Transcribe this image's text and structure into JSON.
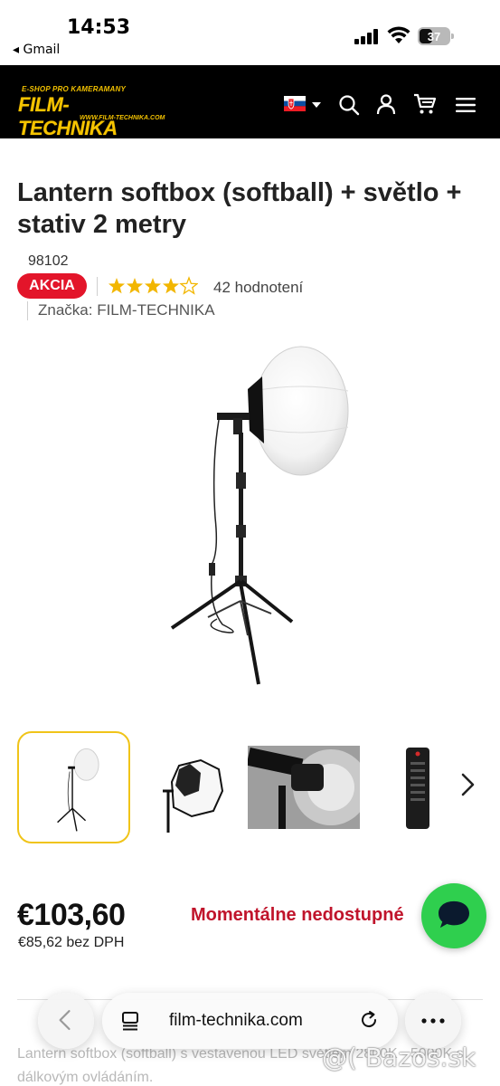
{
  "status_bar": {
    "time": "14:53",
    "back_app": "◂ Gmail",
    "battery": "37"
  },
  "header": {
    "logo_tagline": "E-SHOP PRO KAMERAMANY",
    "logo_name": "FILM-TECHNIKA",
    "logo_url": "WWW.FILM-TECHNIKA.COM",
    "language_flag": "slovakia-flag-icon",
    "icons": [
      "search-icon",
      "user-icon",
      "cart-icon",
      "menu-icon"
    ],
    "brand_color": "#f5c400"
  },
  "product": {
    "title": "Lantern softbox (softball) + světlo + stativ 2 metry",
    "sku": "98102",
    "badge": "AKCIA",
    "rating": 4,
    "rating_max": 5,
    "reviews": "42 hodnotení",
    "brand": "Značka: FILM-TECHNIKA"
  },
  "gallery": {
    "thumbnails": [
      "lantern-on-stand-thumb",
      "softbox-octagon-thumb",
      "light-head-closeup-thumb",
      "remote-control-thumb"
    ],
    "active_index": 0
  },
  "pricing": {
    "price": "€103,60",
    "price_net": "€85,62 bez DPH",
    "availability": "Momentálne nedostupné",
    "availability_color": "#c0142b"
  },
  "description": {
    "text": "Lantern softbox (softball) s vestavenou LED světlem 2800K - 5000K s dálkovým ovládáním."
  },
  "browser": {
    "url": "film-technika.com"
  },
  "watermark": "@( Bazos.sk"
}
